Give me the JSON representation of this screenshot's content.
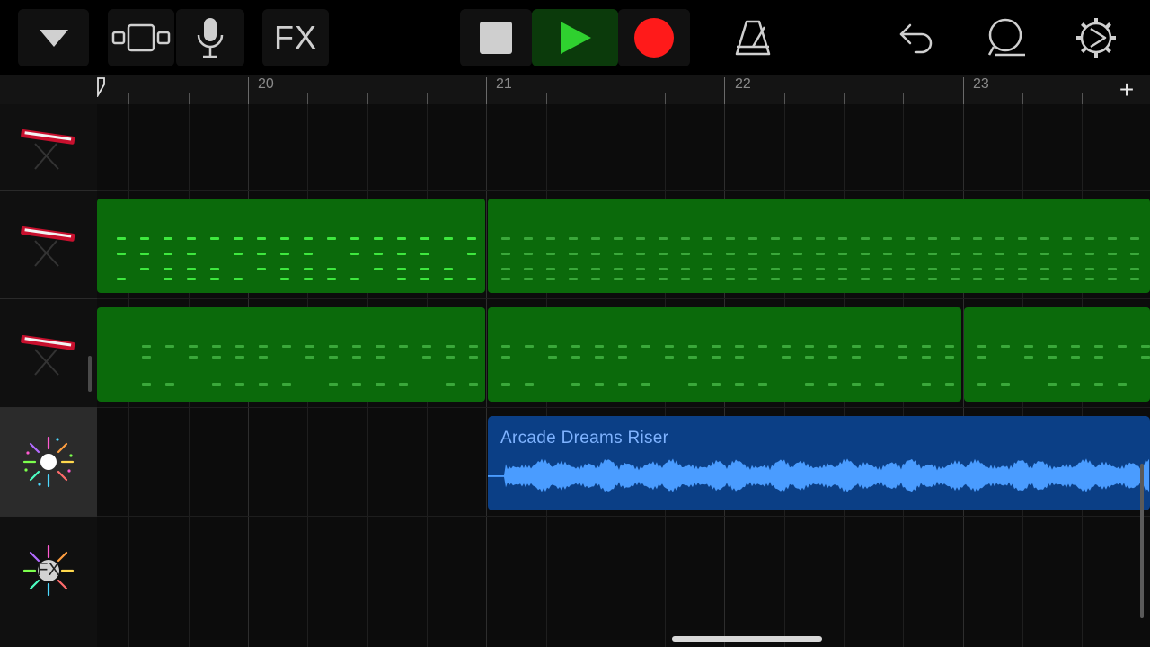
{
  "toolbar": {
    "fx_label": "FX",
    "colors": {
      "play": "#2fd12f",
      "record": "#ff1a1a",
      "stop": "#cfcfcf"
    }
  },
  "ruler": {
    "bars": [
      {
        "label": "20"
      },
      {
        "label": "21"
      },
      {
        "label": "22"
      },
      {
        "label": "23"
      }
    ],
    "add_label": "+"
  },
  "tracks": [
    {
      "icon": "keyboard-icon",
      "selected": false
    },
    {
      "icon": "keyboard-icon",
      "selected": false
    },
    {
      "icon": "keyboard-icon",
      "selected": false
    },
    {
      "icon": "particles-icon",
      "selected": true
    },
    {
      "icon": "fx-particles-icon",
      "label": "FX",
      "selected": false
    }
  ],
  "regions": {
    "audio_title": "Arcade Dreams Riser",
    "midi_color": "#0b6a0b",
    "audio_color": "#0b3f86"
  }
}
